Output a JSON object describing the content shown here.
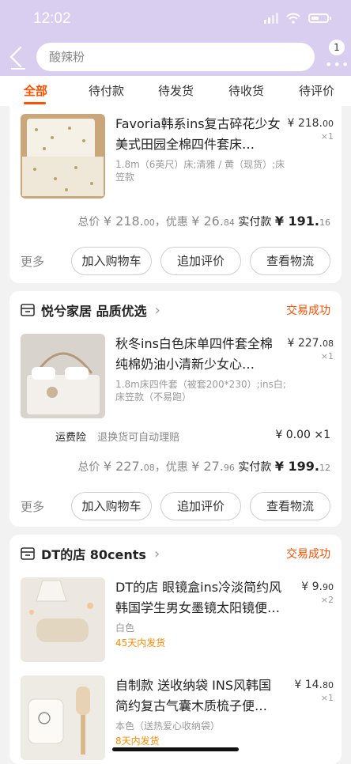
{
  "status_bar": {
    "time": "12:02"
  },
  "search": {
    "placeholder": "酸辣粉",
    "more_badge": "1"
  },
  "tabs": [
    {
      "label": "全部",
      "active": true
    },
    {
      "label": "待付款"
    },
    {
      "label": "待发货"
    },
    {
      "label": "待收货"
    },
    {
      "label": "待评价"
    }
  ],
  "orders": [
    {
      "items": [
        {
          "title": "Favoria韩系ins复古碎花少女美式田园全棉四件套床…",
          "price_main": "¥ 218.",
          "price_cents": "00",
          "qty": "×1",
          "spec": "1.8m（6英尺）床;清雅 / 黄（现货）;床笠款"
        }
      ],
      "summary": {
        "total_label": "总价",
        "total_main": "¥ 218.",
        "total_cents": "00",
        "discount_label": "，优惠",
        "discount_main": "¥ 26.",
        "discount_cents": "84",
        "paid_label": "实付款",
        "paid_main": "¥ 191.",
        "paid_cents": "16"
      },
      "actions": {
        "more": "更多",
        "add_cart": "加入购物车",
        "review": "追加评价",
        "logistics": "查看物流"
      }
    },
    {
      "shop_name": "悦兮家居 品质优选",
      "status": "交易成功",
      "items": [
        {
          "title": "秋冬ins白色床单四件套全棉纯棉奶油小清新少女心…",
          "price_main": "¥ 227.",
          "price_cents": "08",
          "qty": "×1",
          "spec": "1.8m床四件套（被套200*230）;ins白;床笠款（不易跑）"
        }
      ],
      "insurance": {
        "label": "运费险",
        "desc": "退换货可自动理赔",
        "price": "¥ 0.00 ×1"
      },
      "summary": {
        "total_label": "总价",
        "total_main": "¥ 227.",
        "total_cents": "08",
        "discount_label": "，优惠",
        "discount_main": "¥ 27.",
        "discount_cents": "96",
        "paid_label": "实付款",
        "paid_main": "¥ 199.",
        "paid_cents": "12"
      },
      "actions": {
        "more": "更多",
        "add_cart": "加入购物车",
        "review": "追加评价",
        "logistics": "查看物流"
      }
    },
    {
      "shop_name": "DT的店 80cents",
      "status": "交易成功",
      "items": [
        {
          "title": "DT的店 眼镜盒ins冷淡简约风韩国学生男女墨镜太阳镜便…",
          "price_main": "¥ 9.",
          "price_cents": "90",
          "qty": "×2",
          "spec": "白色",
          "ship": "45天内发货"
        },
        {
          "title": "自制款 送收纳袋 INS风韩国简约复古气囊木质梳子便…",
          "price_main": "¥ 14.",
          "price_cents": "80",
          "qty": "×1",
          "spec": "本色（送热爱心收纳袋）",
          "ship": "8天内发货"
        }
      ]
    }
  ],
  "colors": {
    "accent": "#ff5000",
    "header_bg": "#d9cdf0",
    "ship_text": "#ff8a00"
  }
}
